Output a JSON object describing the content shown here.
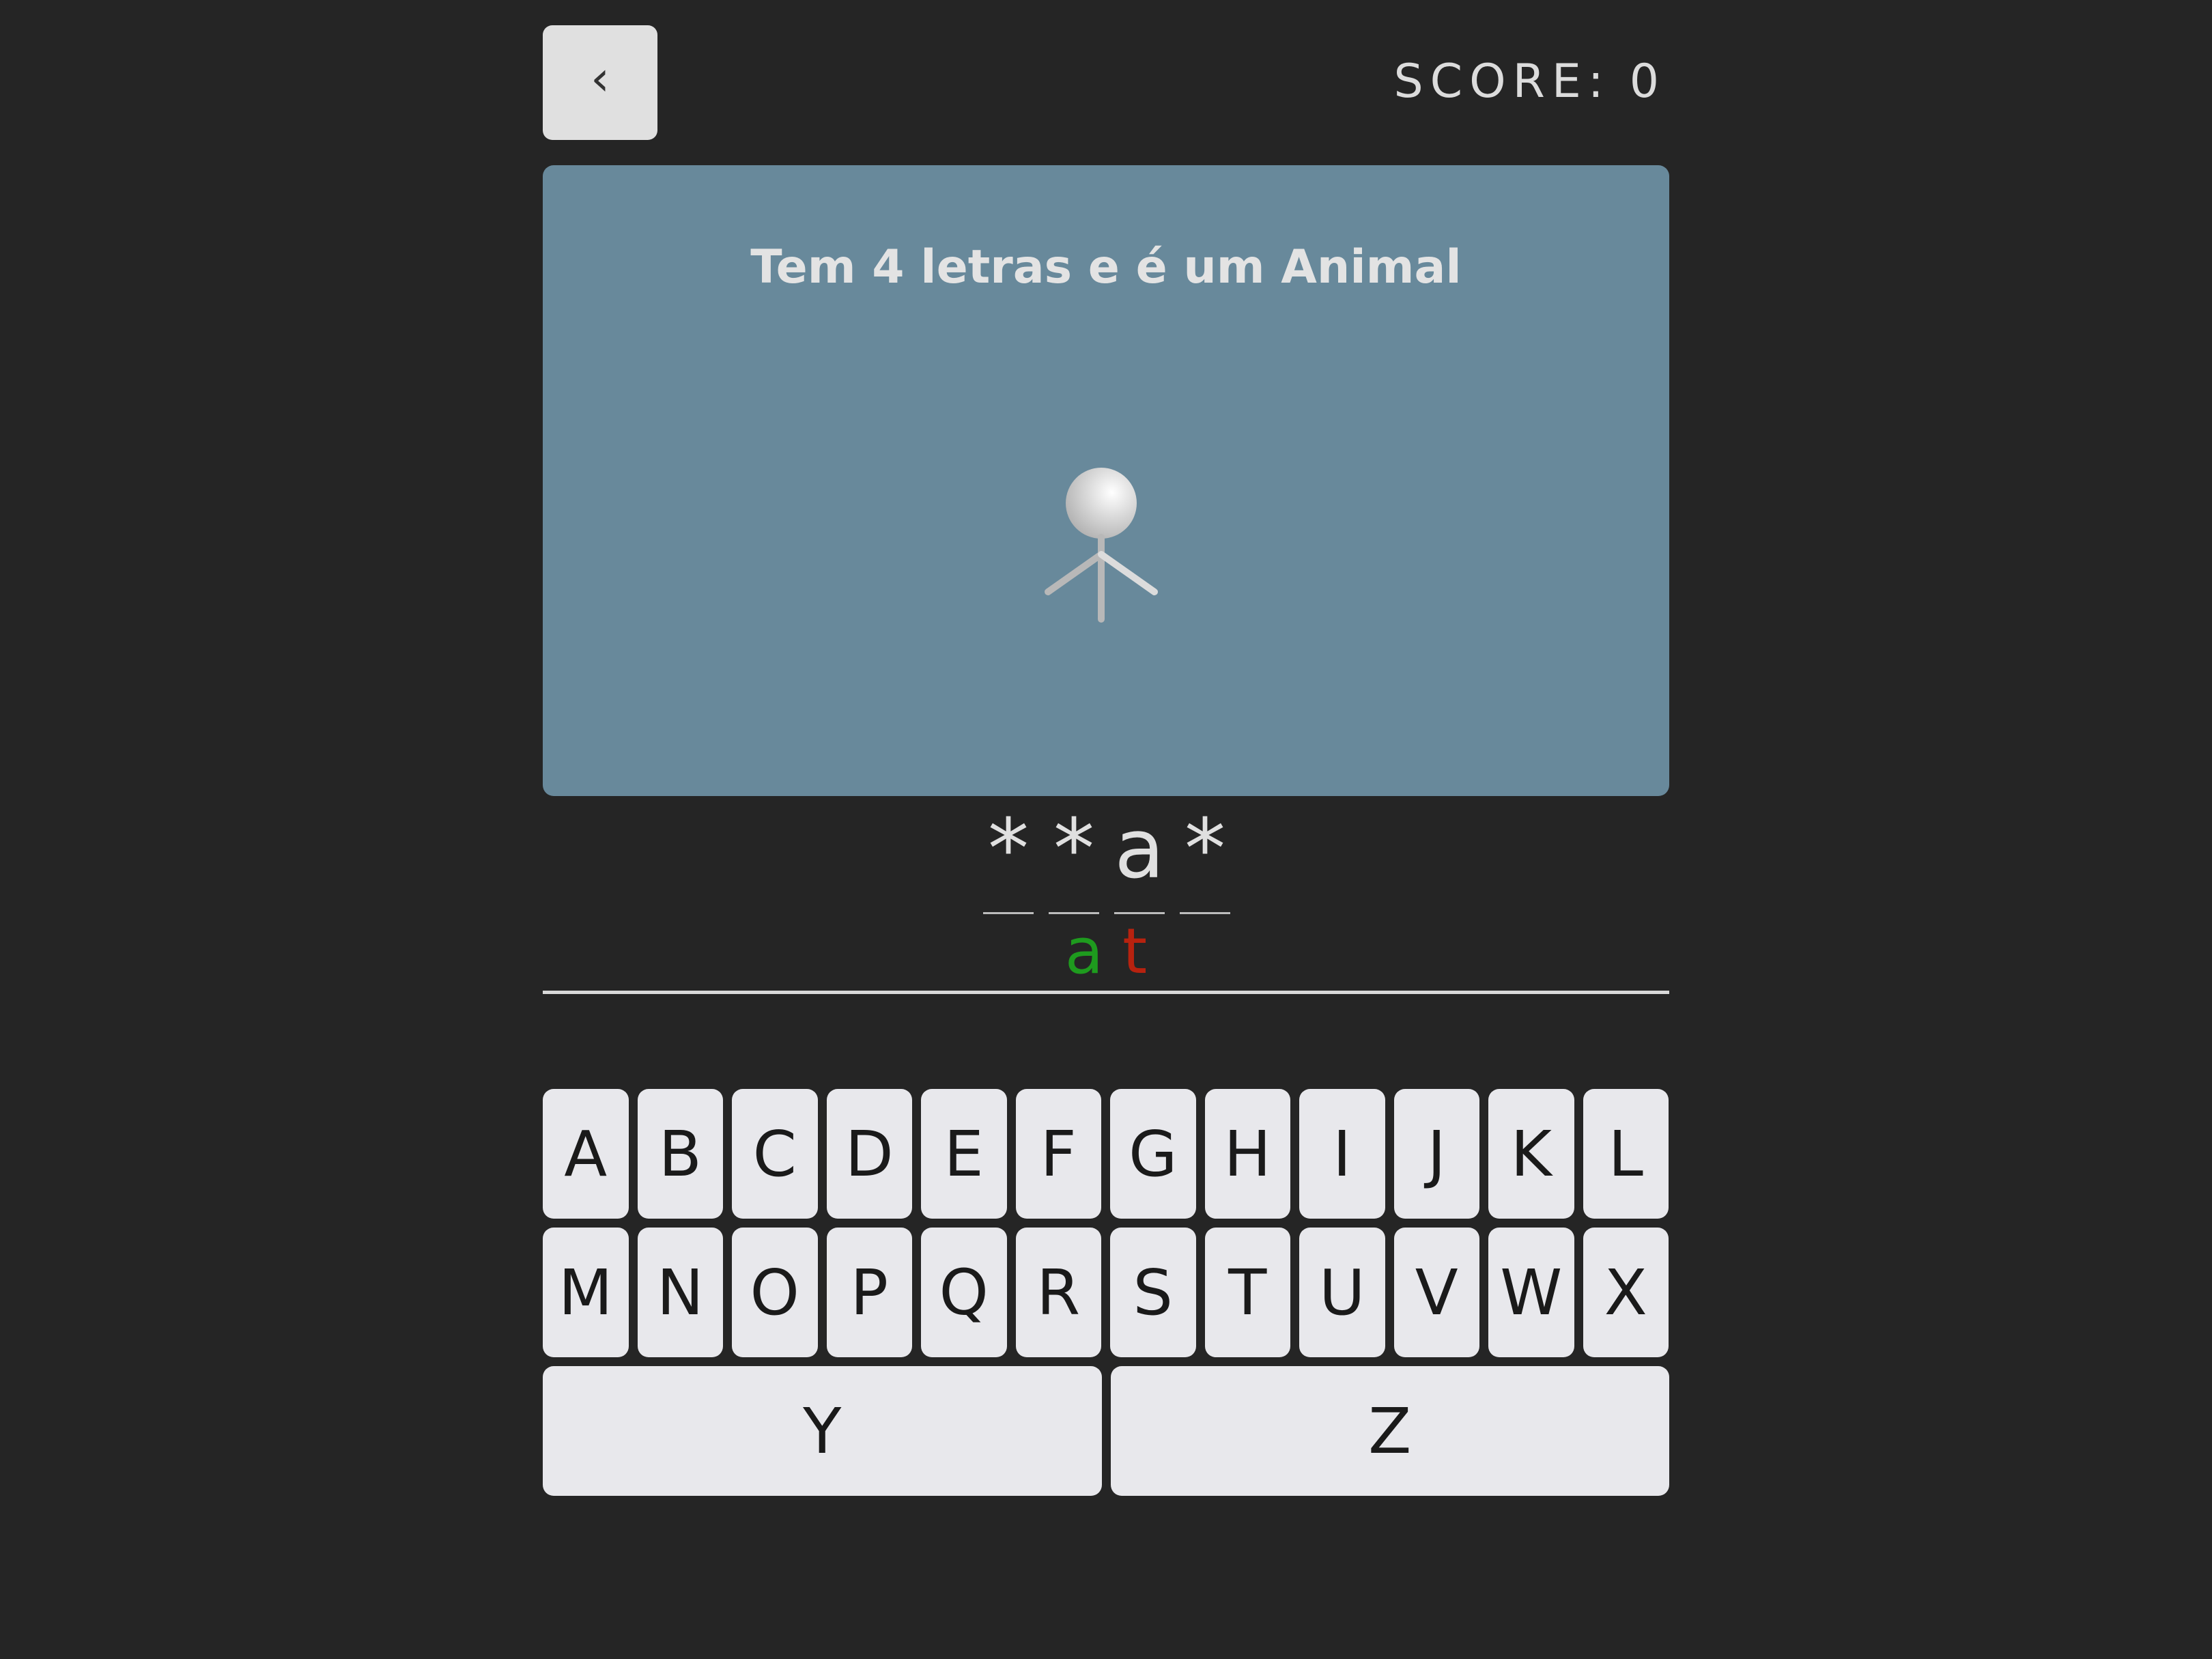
{
  "header": {
    "back_icon": "‹",
    "score_label": "SCORE:",
    "score_value": "0"
  },
  "card": {
    "hint": "Tem 4 letras e é um Animal"
  },
  "word": [
    {
      "char": "*"
    },
    {
      "char": "*"
    },
    {
      "char": "a"
    },
    {
      "char": "*"
    }
  ],
  "guessed": {
    "correct": "a",
    "wrong": "t",
    "correct_color": "#1e9b1e",
    "wrong_color": "#b7220f"
  },
  "keyboard": {
    "row1": [
      "A",
      "B",
      "C",
      "D",
      "E",
      "F",
      "G",
      "H",
      "I",
      "J",
      "K",
      "L"
    ],
    "row2": [
      "M",
      "N",
      "O",
      "P",
      "Q",
      "R",
      "S",
      "T",
      "U",
      "V",
      "W",
      "X"
    ],
    "row3": [
      "Y",
      "Z"
    ]
  },
  "colors": {
    "background": "#252525",
    "card": "#68899b",
    "gallows_start": "#ff3b3b",
    "gallows_end": "#ff9642"
  }
}
